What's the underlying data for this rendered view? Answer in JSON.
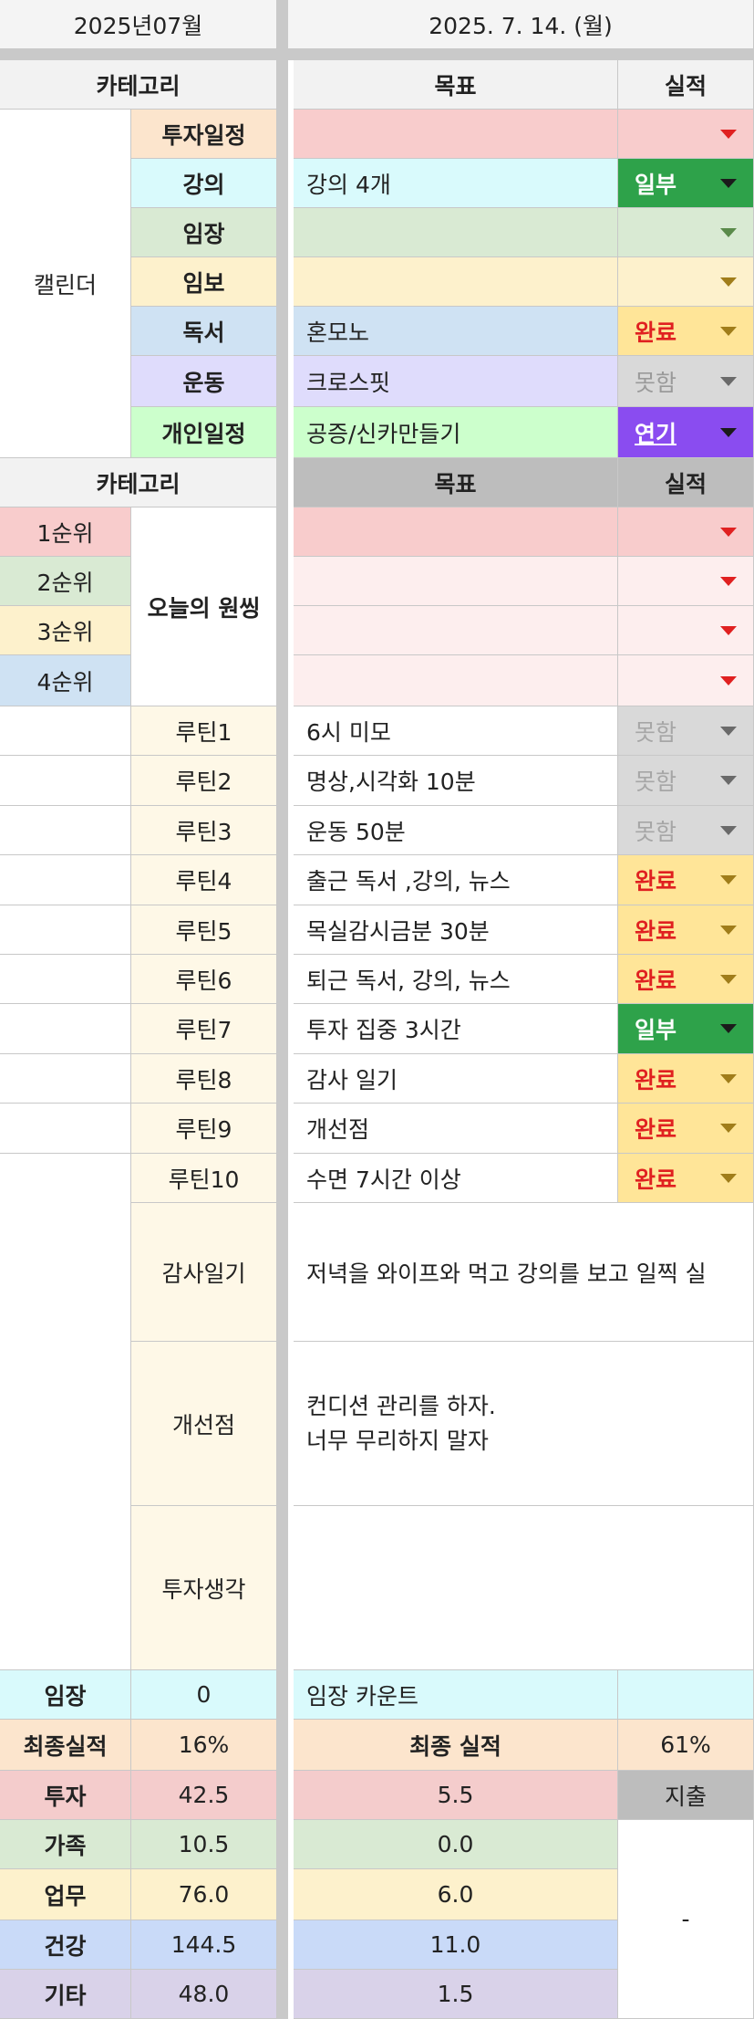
{
  "header": {
    "month": "2025년07월",
    "date": "2025. 7. 14. (월)"
  },
  "calendar": {
    "section_label": "캘린더",
    "head": {
      "category": "카테고리",
      "goal": "목표",
      "result": "실적"
    },
    "rows": [
      {
        "cat": "투자일정",
        "goal": "",
        "status": ""
      },
      {
        "cat": "강의",
        "goal": "강의 4개",
        "status": "일부"
      },
      {
        "cat": "임장",
        "goal": "",
        "status": ""
      },
      {
        "cat": "임보",
        "goal": "",
        "status": ""
      },
      {
        "cat": "독서",
        "goal": "혼모노",
        "status": "완료"
      },
      {
        "cat": "운동",
        "goal": "크로스핏",
        "status": "못함"
      },
      {
        "cat": "개인일정",
        "goal": "공증/신카만들기",
        "status": "연기"
      }
    ]
  },
  "priorities": {
    "head": {
      "category": "카테고리",
      "goal": "목표",
      "result": "실적"
    },
    "group_label": "오늘의 원씽",
    "rows": [
      {
        "rank": "1순위",
        "goal": "",
        "status": ""
      },
      {
        "rank": "2순위",
        "goal": "",
        "status": ""
      },
      {
        "rank": "3순위",
        "goal": "",
        "status": ""
      },
      {
        "rank": "4순위",
        "goal": "",
        "status": ""
      }
    ]
  },
  "routines": [
    {
      "name": "루틴1",
      "goal": "6시 미모",
      "status": "못함"
    },
    {
      "name": "루틴2",
      "goal": "명상,시각화 10분",
      "status": "못함"
    },
    {
      "name": "루틴3",
      "goal": "운동 50분",
      "status": "못함"
    },
    {
      "name": "루틴4",
      "goal": "출근 독서 ,강의, 뉴스",
      "status": "완료"
    },
    {
      "name": "루틴5",
      "goal": "목실감시금분 30분",
      "status": "완료"
    },
    {
      "name": "루틴6",
      "goal": "퇴근 독서, 강의, 뉴스",
      "status": "완료"
    },
    {
      "name": "루틴7",
      "goal": "투자 집중 3시간",
      "status": "일부"
    },
    {
      "name": "루틴8",
      "goal": "감사 일기",
      "status": "완료"
    },
    {
      "name": "루틴9",
      "goal": "개선점",
      "status": "완료"
    },
    {
      "name": "루틴10",
      "goal": "수면 7시간 이상",
      "status": "완료"
    }
  ],
  "journal": {
    "gratitude": {
      "label": "감사일기",
      "text": "저녁을 와이프와 먹고 강의를 보고 일찍 실"
    },
    "improvement": {
      "label": "개선점",
      "text": "컨디션 관리를 하자.\n너무 무리하지 말자"
    },
    "investment": {
      "label": "투자생각",
      "text": ""
    }
  },
  "site_visit": {
    "label": "임장",
    "value": "0",
    "desc": "임장 카운트",
    "extra": ""
  },
  "final": {
    "label": "최종실적",
    "value": "16%",
    "mid_label": "최종 실적",
    "mid_value": "61%"
  },
  "spending": {
    "rows": [
      {
        "label": "투자",
        "a": "42.5",
        "b": "5.5"
      },
      {
        "label": "가족",
        "a": "10.5",
        "b": "0.0"
      },
      {
        "label": "업무",
        "a": "76.0",
        "b": "6.0"
      },
      {
        "label": "건강",
        "a": "144.5",
        "b": "11.0"
      },
      {
        "label": "기타",
        "a": "48.0",
        "b": "1.5"
      }
    ],
    "expense_label": "지출",
    "expense_value": "-"
  },
  "colors": {
    "pink": "#f8cccc",
    "cyan": "#d9fafc",
    "green": "#d9ead3",
    "yellow": "#fdf1cc",
    "blue": "#cfe2f3",
    "lavender": "#dfdcfc",
    "mint": "#ccffcc",
    "peach": "#fce5cd",
    "lightpink": "#fdeeee",
    "cream": "#fef8e7",
    "purple": "#d9d2e9",
    "status_partial": "#2ea24a",
    "status_done": "#ffe598",
    "status_fail": "#d9d9d9",
    "status_delay": "#8a4cf0"
  }
}
